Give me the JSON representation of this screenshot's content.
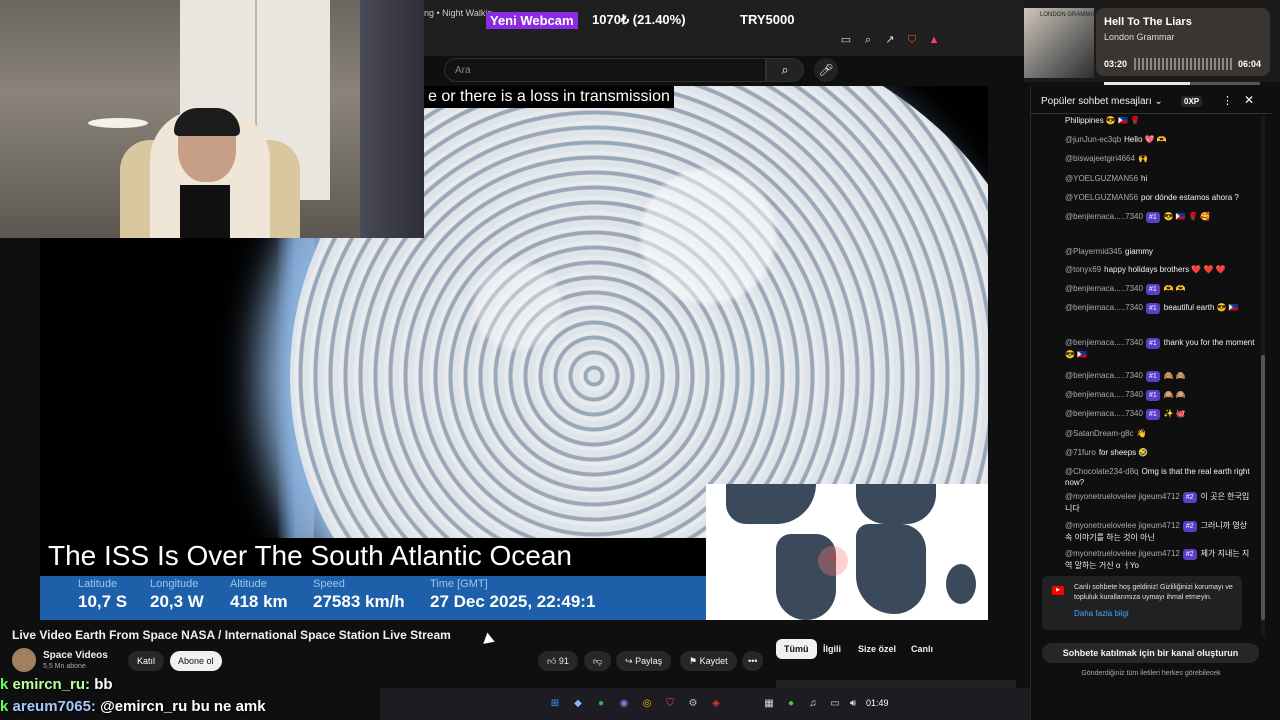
{
  "browser": {
    "tab_title": "ng • Night Walkin"
  },
  "stream_overlay": {
    "webcam_label": "Yeni Webcam",
    "donation": "1070₺ (21.40%)",
    "goal": "TRY5000"
  },
  "search": {
    "placeholder": "Ara"
  },
  "video": {
    "subtitle": "e or there is a loss in transmission",
    "caption": "The ISS Is Over The South Atlantic Ocean",
    "telemetry": {
      "headers": [
        "Latitude",
        "Longitude",
        "Altitude",
        "Speed",
        "Time [GMT]"
      ],
      "values": [
        "10,7 S",
        "20,3 W",
        "418 km",
        "27583 km/h",
        "27 Dec 2025, 22:49:1"
      ]
    },
    "title": "Live Video Earth From Space NASA / International Space Station Live Stream",
    "channel": {
      "name": "Space Videos",
      "subs": "5,5 Mn abone",
      "join_label": "Katıl",
      "subscribe_label": "Abone ol"
    },
    "actions": {
      "likes": "91",
      "share_label": "Paylaş",
      "save_label": "Kaydet",
      "more_label": "•••"
    }
  },
  "filters": [
    "Tümü",
    "İlgili",
    "Size özel",
    "Canlı"
  ],
  "overlay_chat": [
    {
      "user": "emircn_ru:",
      "text": "bb",
      "prefix": "k"
    },
    {
      "user": "areum7065:",
      "text": "@emircn_ru bu ne amk",
      "prefix": "k"
    }
  ],
  "music": {
    "album_text": "LONDON GRAMMAR",
    "title": "Hell To The Liars",
    "artist": "London Grammar",
    "elapsed": "03:20",
    "duration": "06:04",
    "progress": 0.55
  },
  "chat": {
    "title": "Popüler sohbet mesajları",
    "xp": "0XP",
    "messages": [
      {
        "author": "",
        "text": "Philippines 😎 🇵🇭 🌹",
        "badge": ""
      },
      {
        "author": "@junJun-ec3qb",
        "text": "Hello 💖 🫶",
        "badge": ""
      },
      {
        "author": "@biswajeetgiri4664",
        "text": "🙌",
        "badge": ""
      },
      {
        "author": "@YOELGUZMAN56",
        "text": "hi",
        "badge": ""
      },
      {
        "author": "@YOELGUZMAN56",
        "text": "por dónde estamos ahora ?",
        "badge": ""
      },
      {
        "author": "@benjiemaca.....7340",
        "text": "😎 🇵🇭 🌹 🥰",
        "badge": "#1"
      },
      {
        "author": "@Playermid345",
        "text": "giammy",
        "badge": ""
      },
      {
        "author": "@tonyx69",
        "text": "happy holidays brothers ❤️ ❤️ ❤️",
        "badge": ""
      },
      {
        "author": "@benjiemaca.....7340",
        "text": "🫶 🫶",
        "badge": "#1"
      },
      {
        "author": "@benjiemaca.....7340",
        "text": "beautiful earth 😎 🇵🇭",
        "badge": "#1"
      },
      {
        "author": "@benjiemaca.....7340",
        "text": "thank you for the moment 😎 🇵🇭",
        "badge": "#1"
      },
      {
        "author": "@benjiemaca.....7340",
        "text": "🙈 🙈",
        "badge": "#1"
      },
      {
        "author": "@benjiemaca.....7340",
        "text": "🙉 🙉",
        "badge": "#1"
      },
      {
        "author": "@benjiemaca.....7340",
        "text": "✨ 🐙",
        "badge": "#1"
      },
      {
        "author": "@SatanDream-g8c",
        "text": "👋",
        "badge": ""
      },
      {
        "author": "@71furo",
        "text": "for sheeps 🤣",
        "badge": ""
      },
      {
        "author": "@Chocolate234-d8q",
        "text": "Omg is that the real earth right now?",
        "badge": ""
      },
      {
        "author": "@myonetruelovelee jigeum4712",
        "text": "이 곳은 한국입니다",
        "badge": "#2"
      },
      {
        "author": "@myonetruelovelee jigeum4712",
        "text": "그러니까 영상 속 이야기를 하는 것이 아닌",
        "badge": "#2"
      },
      {
        "author": "@myonetruelovelee jigeum4712",
        "text": "제가 지내는 지역 말하는 거신 o ㅓYo",
        "badge": "#2"
      }
    ],
    "welcome": "Canlı sohbete hoş geldiniz! Gizliliğinizi korumayı ve topluluk kurallarımıza uymayı ihmal etmeyin.",
    "welcome_link": "Daha fazla bilgi",
    "create_channel": "Sohbete katılmak için bir kanal oluşturun",
    "footer": "Gönderdiğiniz tüm iletileri herkes görebilecek"
  },
  "taskbar": {
    "clock": "01:49"
  }
}
